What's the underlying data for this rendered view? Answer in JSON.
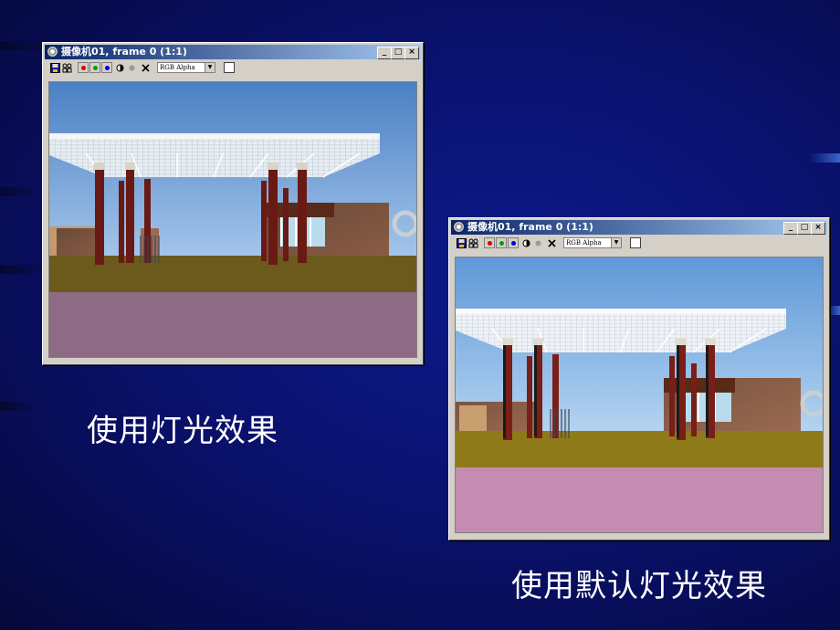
{
  "windows": [
    {
      "title": "摄像机01, frame 0 (1:1)",
      "channel_select": "RGB Alpha",
      "title_buttons": [
        "_",
        "□",
        "×"
      ]
    },
    {
      "title": "摄像机01, frame 0 (1:1)",
      "channel_select": "RGB Alpha",
      "title_buttons": [
        "_",
        "□",
        "×"
      ]
    }
  ],
  "captions": {
    "left": "使用灯光效果",
    "right": "使用默认灯光效果"
  },
  "icons": [
    "camera-icon",
    "save-icon",
    "clone-icon",
    "red-channel-icon",
    "green-channel-icon",
    "blue-channel-icon",
    "mono-icon",
    "alpha-icon",
    "clear-icon"
  ],
  "colors": {
    "background": "#0a1270",
    "title_gradient_start": "#0a246a",
    "sky_lit": "#5a8fd0",
    "sky_default": "#6fa6e0",
    "ground_lit": "#6b5a1c",
    "ground_default": "#8f7a1a",
    "plaza_lit": "#8e6b85",
    "plaza_default": "#c38cb0"
  }
}
